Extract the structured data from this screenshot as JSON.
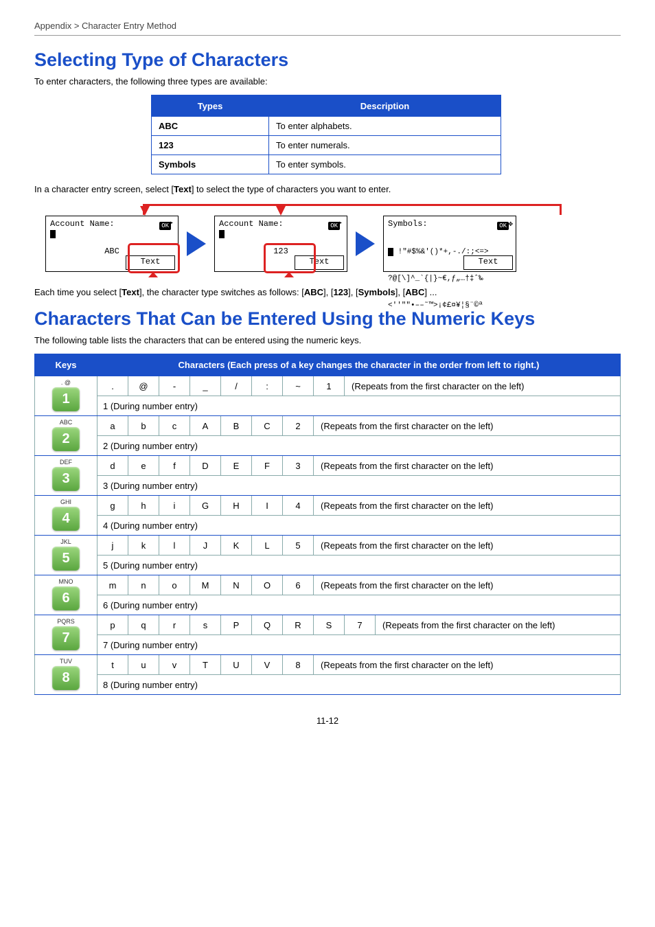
{
  "breadcrumb": "Appendix > Character Entry Method",
  "h1a": "Selecting Type of Characters",
  "intro1": "To enter characters, the following three types are available:",
  "types_table": {
    "head": [
      "Types",
      "Description"
    ],
    "rows": [
      [
        "ABC",
        "To enter alphabets."
      ],
      [
        "123",
        "To enter numerals."
      ],
      [
        "Symbols",
        "To enter symbols."
      ]
    ]
  },
  "para2_pre": "In a character entry screen, select [",
  "para2_b": "Text",
  "para2_post": "] to select the type of characters you want to enter.",
  "screen_title": "Account Name:",
  "screen_ok": "OK",
  "screen_mode_abc": "ABC",
  "screen_mode_123": "123",
  "screen_text": "Text",
  "sym_title": "Symbols:",
  "sym_l1": " !\"#$%&'()*+,-./:;<=>",
  "sym_l2": "?@[\\]^_`{|}~€,ƒ„…†‡ˆ‰",
  "sym_l3": "<''\"\"•––˜™>¡¢£¤¥¦§¨©ª",
  "switch_pre": "Each time you select [",
  "switch_b1": "Text",
  "switch_mid": "], the character type switches as follows: [",
  "switch_b2": "ABC",
  "switch_m2": "], [",
  "switch_b3": "123",
  "switch_m3": "], [",
  "switch_b4": "Symbols",
  "switch_m4": "], [",
  "switch_b5": "ABC",
  "switch_end": "] ...",
  "h1b": "Characters That Can be Entered Using the Numeric Keys",
  "intro2": "The following table lists the characters that can be entered using the numeric keys.",
  "chars_head": [
    "Keys",
    "Characters (Each press of a key changes the character in the order from left to right.)"
  ],
  "repeat_text": "(Repeats from the first character on the left)",
  "chart_data": {
    "type": "table",
    "title": "Numeric key character cycle table",
    "rows": [
      {
        "key_label": ". @",
        "digit": "1",
        "chars": [
          ".",
          "@",
          "-",
          "_",
          "/",
          ":",
          "~",
          "1"
        ],
        "num_entry": "1 (During number entry)"
      },
      {
        "key_label": "ABC",
        "digit": "2",
        "chars": [
          "a",
          "b",
          "c",
          "A",
          "B",
          "C",
          "2"
        ],
        "num_entry": "2 (During number entry)"
      },
      {
        "key_label": "DEF",
        "digit": "3",
        "chars": [
          "d",
          "e",
          "f",
          "D",
          "E",
          "F",
          "3"
        ],
        "num_entry": "3 (During number entry)"
      },
      {
        "key_label": "GHI",
        "digit": "4",
        "chars": [
          "g",
          "h",
          "i",
          "G",
          "H",
          "I",
          "4"
        ],
        "num_entry": "4 (During number entry)"
      },
      {
        "key_label": "JKL",
        "digit": "5",
        "chars": [
          "j",
          "k",
          "l",
          "J",
          "K",
          "L",
          "5"
        ],
        "num_entry": "5 (During number entry)"
      },
      {
        "key_label": "MNO",
        "digit": "6",
        "chars": [
          "m",
          "n",
          "o",
          "M",
          "N",
          "O",
          "6"
        ],
        "num_entry": "6 (During number entry)"
      },
      {
        "key_label": "PQRS",
        "digit": "7",
        "chars": [
          "p",
          "q",
          "r",
          "s",
          "P",
          "Q",
          "R",
          "S",
          "7"
        ],
        "num_entry": "7 (During number entry)"
      },
      {
        "key_label": "TUV",
        "digit": "8",
        "chars": [
          "t",
          "u",
          "v",
          "T",
          "U",
          "V",
          "8"
        ],
        "num_entry": "8 (During number entry)"
      }
    ]
  },
  "page_num": "11-12"
}
